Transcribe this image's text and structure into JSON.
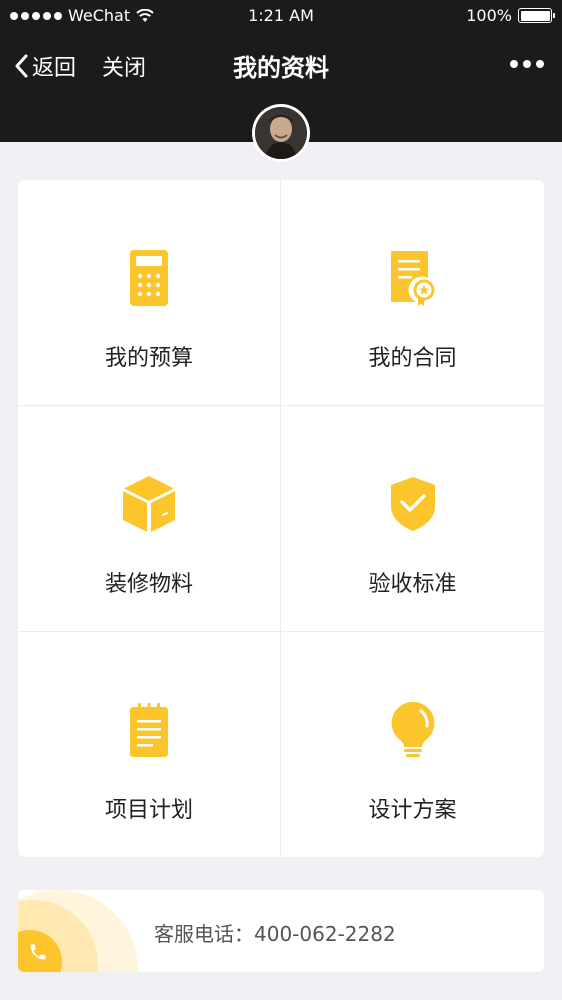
{
  "status_bar": {
    "carrier": "WeChat",
    "time": "1:21 AM",
    "battery": "100%"
  },
  "nav": {
    "back_label": "返回",
    "close_label": "关闭",
    "title": "我的资料"
  },
  "menu": [
    {
      "label": "我的预算",
      "icon": "calculator-icon"
    },
    {
      "label": "我的合同",
      "icon": "contract-icon"
    },
    {
      "label": "装修物料",
      "icon": "box-icon"
    },
    {
      "label": "验收标准",
      "icon": "shield-check-icon"
    },
    {
      "label": "项目计划",
      "icon": "notepad-icon"
    },
    {
      "label": "设计方案",
      "icon": "lightbulb-icon"
    }
  ],
  "service": {
    "text": "客服电话：400-062-2282"
  },
  "colors": {
    "accent": "#fcc52c",
    "header_bg": "#1b1b1b",
    "page_bg": "#efeff4"
  }
}
